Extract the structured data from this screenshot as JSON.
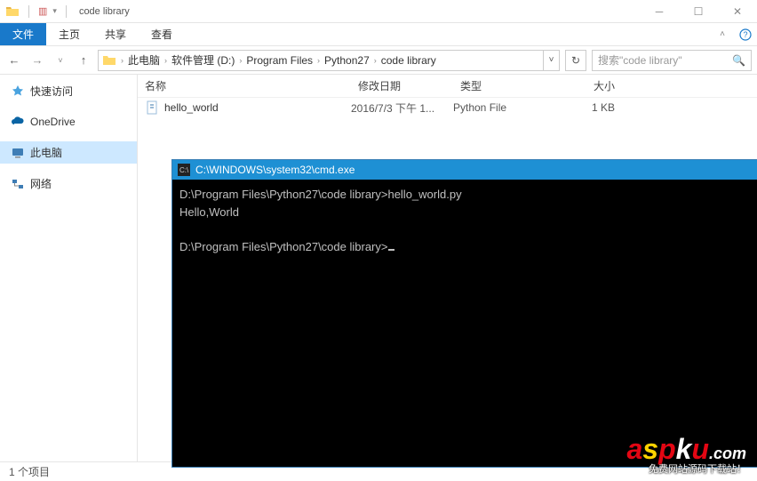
{
  "window": {
    "title": "code library",
    "min_tooltip": "最小化",
    "max_tooltip": "最大化",
    "close_tooltip": "关闭"
  },
  "ribbon": {
    "file": "文件",
    "home": "主页",
    "share": "共享",
    "view": "查看"
  },
  "breadcrumb": {
    "root": "此电脑",
    "seg1": "软件管理 (D:)",
    "seg2": "Program Files",
    "seg3": "Python27",
    "seg4": "code library"
  },
  "search": {
    "placeholder": "搜索\"code library\""
  },
  "sidebar": {
    "quick": "快速访问",
    "onedrive": "OneDrive",
    "thispc": "此电脑",
    "network": "网络"
  },
  "columns": {
    "name": "名称",
    "date": "修改日期",
    "type": "类型",
    "size": "大小"
  },
  "files": [
    {
      "name": "hello_world",
      "date": "2016/7/3 下午 1...",
      "type": "Python File",
      "size": "1 KB"
    }
  ],
  "status": {
    "count": "1 个项目"
  },
  "cmd": {
    "title": "C:\\WINDOWS\\system32\\cmd.exe",
    "line1": "D:\\Program Files\\Python27\\code library>hello_world.py",
    "line2": "Hello,World",
    "line3": "D:\\Program Files\\Python27\\code library>"
  },
  "watermark": {
    "domain": ".com",
    "tag": "免费网站源码下载站！"
  }
}
